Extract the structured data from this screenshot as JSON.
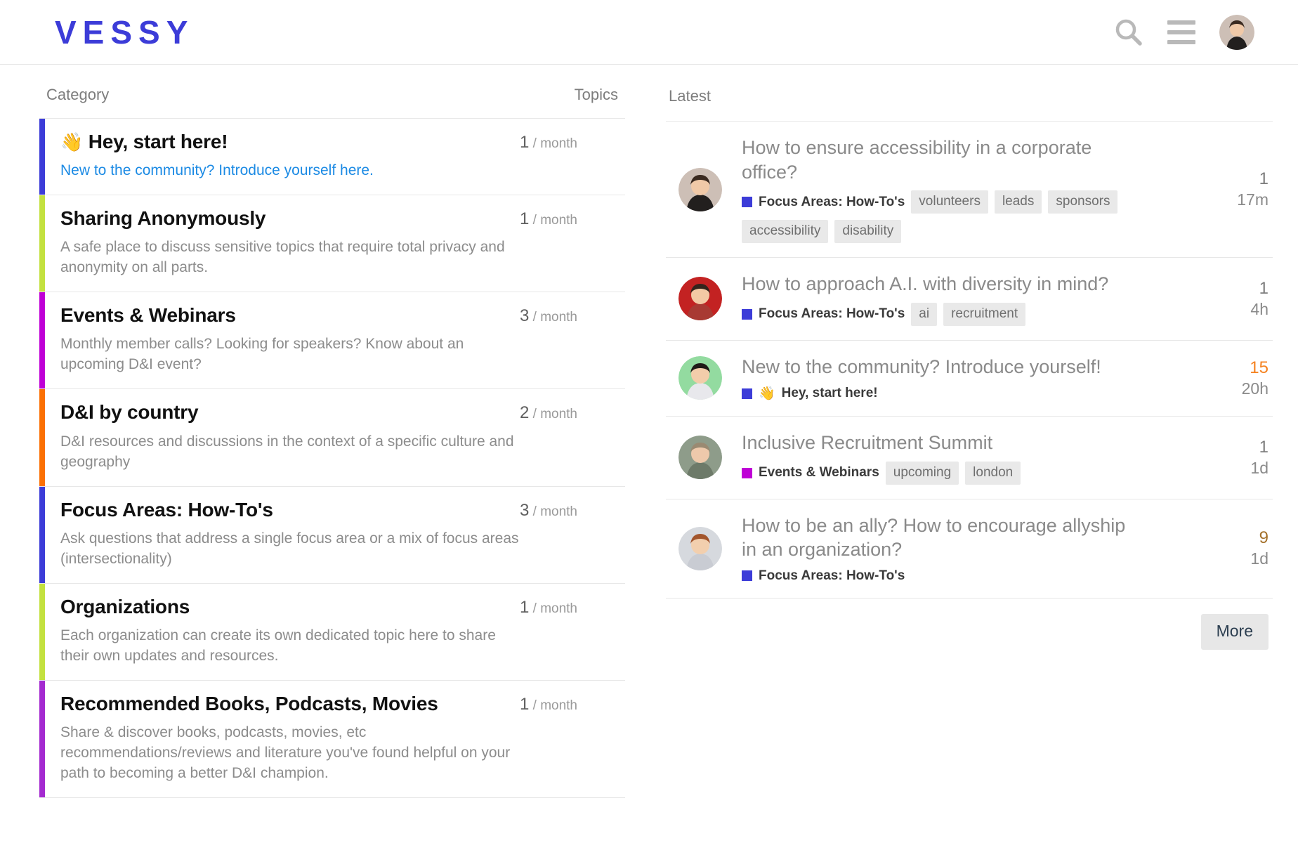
{
  "header": {
    "brand": "VESSY",
    "search_icon": "search-icon",
    "menu_icon": "hamburger-menu-icon",
    "avatar_alt": "user-avatar"
  },
  "colors": {
    "brand_blue": "#3c3cd8",
    "category_blue": "#3c3cd8",
    "category_lime": "#c3e13f",
    "category_magenta": "#bf00d6",
    "category_orange": "#fb7003",
    "category_purple": "#a42ad0",
    "link_blue": "#1b8ae4",
    "hot_orange": "#f58220",
    "warm_brown": "#a4712b",
    "tag_bg": "#e9e9e9"
  },
  "categories_panel": {
    "heading_category": "Category",
    "heading_topics": "Topics",
    "rows": [
      {
        "emoji": "👋",
        "title": "Hey, start here!",
        "description": "New to the community? Introduce yourself here.",
        "description_is_link": true,
        "count": "1",
        "per": "/ month",
        "color": "#3c3cd8"
      },
      {
        "emoji": "",
        "title": "Sharing Anonymously",
        "description": "A safe place to discuss sensitive topics that require total privacy and anonymity on all parts.",
        "description_is_link": false,
        "count": "1",
        "per": "/ month",
        "color": "#c3e13f"
      },
      {
        "emoji": "",
        "title": "Events & Webinars",
        "description": "Monthly member calls? Looking for speakers? Know about an upcoming D&I event?",
        "description_is_link": false,
        "count": "3",
        "per": "/ month",
        "color": "#bf00d6"
      },
      {
        "emoji": "",
        "title": "D&I by country",
        "description": "D&I resources and discussions in the context of a specific culture and geography",
        "description_is_link": false,
        "count": "2",
        "per": "/ month",
        "color": "#fb7003"
      },
      {
        "emoji": "",
        "title": "Focus Areas: How-To's",
        "description": "Ask questions that address a single focus area or a mix of focus areas (intersectionality)",
        "description_is_link": false,
        "count": "3",
        "per": "/ month",
        "color": "#3c3cd8"
      },
      {
        "emoji": "",
        "title": "Organizations",
        "description": "Each organization can create its own dedicated topic here to share their own updates and resources.",
        "description_is_link": false,
        "count": "1",
        "per": "/ month",
        "color": "#c3e13f"
      },
      {
        "emoji": "",
        "title": "Recommended Books, Podcasts, Movies",
        "description": "Share & discover books, podcasts, movies, etc recommendations/reviews and literature you've found helpful on your path to becoming a better D&I champion.",
        "description_is_link": false,
        "count": "1",
        "per": "/ month",
        "color": "#a42ad0"
      }
    ]
  },
  "latest_panel": {
    "heading": "Latest",
    "more_label": "More",
    "topics": [
      {
        "title": "How to ensure accessibility in a corporate office?",
        "category": "Focus Areas: How-To's",
        "category_emoji": "",
        "category_color": "#3c3cd8",
        "tags": [
          "volunteers",
          "leads",
          "sponsors",
          "accessibility",
          "disability"
        ],
        "replies": "1",
        "replies_state": "normal",
        "age": "17m",
        "avatar_bg": "#cdbfb6",
        "avatar_skin": "#f0c9a8",
        "avatar_hair": "#3a2a20",
        "avatar_shirt": "#221f1e"
      },
      {
        "title": "How to approach A.I. with diversity in mind?",
        "category": "Focus Areas: How-To's",
        "category_emoji": "",
        "category_color": "#3c3cd8",
        "tags": [
          "ai",
          "recruitment"
        ],
        "replies": "1",
        "replies_state": "normal",
        "age": "4h",
        "avatar_bg": "#c32222",
        "avatar_skin": "#f3c9a4",
        "avatar_hair": "#33241c",
        "avatar_shirt": "#a83a33"
      },
      {
        "title": "New to the community? Introduce yourself!",
        "category": "Hey, start here!",
        "category_emoji": "👋",
        "category_color": "#3c3cd8",
        "tags": [],
        "replies": "15",
        "replies_state": "hot",
        "age": "20h",
        "avatar_bg": "#93dba0",
        "avatar_skin": "#f2cdaa",
        "avatar_hair": "#1f1a17",
        "avatar_shirt": "#e8e8ec"
      },
      {
        "title": "Inclusive Recruitment Summit",
        "category": "Events & Webinars",
        "category_emoji": "",
        "category_color": "#bf00d6",
        "tags": [
          "upcoming",
          "london"
        ],
        "replies": "1",
        "replies_state": "normal",
        "age": "1d",
        "avatar_bg": "#8e9c8a",
        "avatar_skin": "#eec9ab",
        "avatar_hair": "#9a8a72",
        "avatar_shirt": "#6d7a69"
      },
      {
        "title": "How to be an ally? How to encourage allyship in an organization?",
        "category": "Focus Areas: How-To's",
        "category_emoji": "",
        "category_color": "#3c3cd8",
        "tags": [],
        "replies": "9",
        "replies_state": "warm",
        "age": "1d",
        "avatar_bg": "#d6d9de",
        "avatar_skin": "#f2cfae",
        "avatar_hair": "#a2552c",
        "avatar_shirt": "#c9ccd3"
      }
    ]
  }
}
